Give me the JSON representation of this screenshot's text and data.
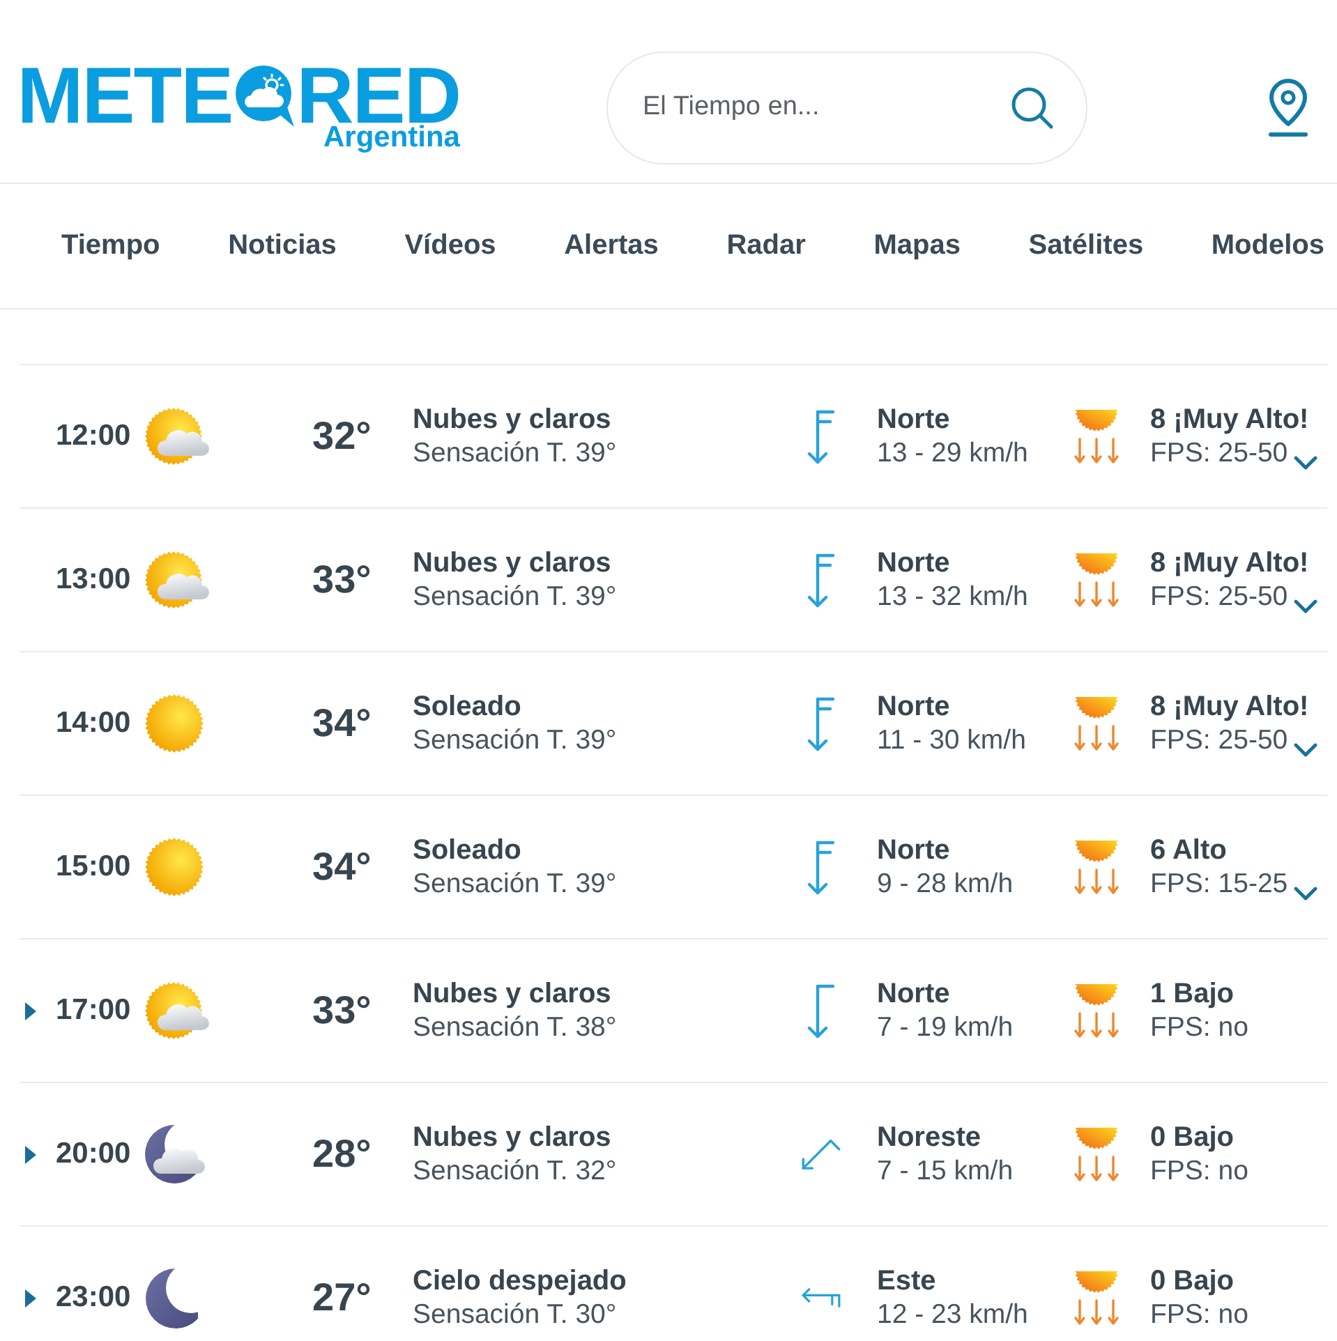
{
  "header": {
    "logo": {
      "text_left": "METE",
      "text_right": "RED",
      "subtitle": "Argentina"
    },
    "search": {
      "placeholder": "El Tiempo en..."
    }
  },
  "nav": [
    {
      "label": "Tiempo",
      "selected": false
    },
    {
      "label": "Noticias",
      "selected": false
    },
    {
      "label": "Vídeos",
      "selected": false
    },
    {
      "label": "Alertas",
      "selected": false
    },
    {
      "label": "Radar",
      "selected": false
    },
    {
      "label": "Mapas",
      "selected": false
    },
    {
      "label": "Satélites",
      "selected": false
    },
    {
      "label": "Modelos",
      "selected": false
    }
  ],
  "hours": [
    {
      "time": "12:00",
      "expandable": false,
      "kind": "day_partly_cloudy",
      "temperature": "32°",
      "sky": "Nubes y claros",
      "feels_like": "Sensación T. 39°",
      "wind": {
        "kind": "south",
        "double_barb": true,
        "direction": "Norte",
        "speed": "13 - 29 km/h"
      },
      "uv": {
        "index": "8 ¡Muy Alto!",
        "fps": "FPS: 25-50",
        "dropdown": true
      }
    },
    {
      "time": "13:00",
      "expandable": false,
      "kind": "day_partly_cloudy",
      "temperature": "33°",
      "sky": "Nubes y claros",
      "feels_like": "Sensación T. 39°",
      "wind": {
        "kind": "south",
        "double_barb": true,
        "direction": "Norte",
        "speed": "13 - 32 km/h"
      },
      "uv": {
        "index": "8 ¡Muy Alto!",
        "fps": "FPS: 25-50",
        "dropdown": true
      }
    },
    {
      "time": "14:00",
      "expandable": false,
      "kind": "day_clear",
      "temperature": "34°",
      "sky": "Soleado",
      "feels_like": "Sensación T. 39°",
      "wind": {
        "kind": "south",
        "double_barb": true,
        "direction": "Norte",
        "speed": "11 - 30 km/h"
      },
      "uv": {
        "index": "8 ¡Muy Alto!",
        "fps": "FPS: 25-50",
        "dropdown": true
      }
    },
    {
      "time": "15:00",
      "expandable": false,
      "kind": "day_clear",
      "temperature": "34°",
      "sky": "Soleado",
      "feels_like": "Sensación T. 39°",
      "wind": {
        "kind": "south",
        "double_barb": true,
        "direction": "Norte",
        "speed": "9 - 28 km/h"
      },
      "uv": {
        "index": "6 Alto",
        "fps": "FPS: 15-25",
        "dropdown": true
      }
    },
    {
      "time": "17:00",
      "expandable": true,
      "kind": "day_partly_cloudy",
      "temperature": "33°",
      "sky": "Nubes y claros",
      "feels_like": "Sensación T. 38°",
      "wind": {
        "kind": "south",
        "double_barb": false,
        "direction": "Norte",
        "speed": "7 - 19 km/h"
      },
      "uv": {
        "index": "1 Bajo",
        "fps": "FPS: no",
        "dropdown": false
      }
    },
    {
      "time": "20:00",
      "expandable": true,
      "kind": "night_partly_cloudy",
      "temperature": "28°",
      "sky": "Nubes y claros",
      "feels_like": "Sensación T. 32°",
      "wind": {
        "kind": "southwest",
        "double_barb": false,
        "direction": "Noreste",
        "speed": "7 - 15 km/h"
      },
      "uv": {
        "index": "0 Bajo",
        "fps": "FPS: no",
        "dropdown": false
      }
    },
    {
      "time": "23:00",
      "expandable": true,
      "kind": "night_clear",
      "temperature": "27°",
      "sky": "Cielo despejado",
      "feels_like": "Sensación T. 30°",
      "wind": {
        "kind": "west",
        "double_barb": true,
        "direction": "Este",
        "speed": "12 - 23 km/h"
      },
      "uv": {
        "index": "0 Bajo",
        "fps": "FPS: no",
        "dropdown": false
      }
    }
  ]
}
